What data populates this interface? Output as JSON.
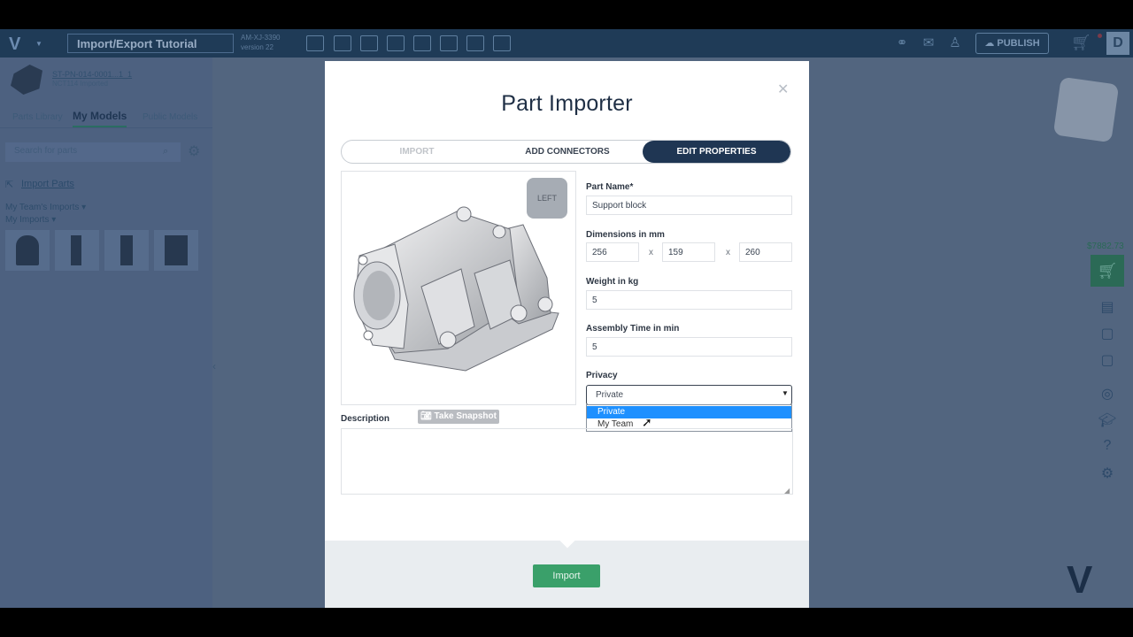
{
  "topbar": {
    "logo": "V",
    "project_title": "Import/Export Tutorial",
    "project_id": "AM-XJ-3390",
    "project_version": "version 22",
    "publish_label": "PUBLISH",
    "avatar_initial": "D",
    "icons": [
      "open-folder-icon",
      "import-icon",
      "branch-icon",
      "save-icon",
      "document-icon",
      "sheet-icon",
      "settings-cube-icon",
      "gears-icon"
    ],
    "right_icons": [
      "link-icon",
      "comment-icon",
      "user-add-icon"
    ]
  },
  "left_panel": {
    "part_id": "ST-PN-014-0001...1_1",
    "part_status_prefix": "NCT114",
    "part_status": "Imported",
    "tabs": [
      "Parts Library",
      "My Models",
      "Public Models"
    ],
    "active_tab": "My Models",
    "search_placeholder": "Search for parts",
    "import_link": "Import Parts",
    "groups": [
      "My Team's Imports ▾",
      "My Imports ▾"
    ]
  },
  "right_toolbar": {
    "price": "$7882.73"
  },
  "modal": {
    "title": "Part Importer",
    "tabs": {
      "import": "IMPORT",
      "add_connectors": "ADD CONNECTORS",
      "edit_properties": "EDIT PROPERTIES"
    },
    "active_tab": "EDIT PROPERTIES",
    "nav_cube_label": "LEFT",
    "snapshot_label": "Take Snapshot",
    "fields": {
      "part_name_label": "Part Name*",
      "part_name_value": "Support block",
      "dimensions_label": "Dimensions in mm",
      "dim_x": "256",
      "dim_y": "159",
      "dim_z": "260",
      "dim_sep": "x",
      "weight_label": "Weight in kg",
      "weight_value": "5",
      "assembly_label": "Assembly Time in min",
      "assembly_value": "5",
      "privacy_label": "Privacy",
      "privacy_value": "Private",
      "privacy_options": [
        "Private",
        "My Team"
      ],
      "description_label": "Description",
      "description_value": ""
    },
    "import_button": "Import"
  }
}
